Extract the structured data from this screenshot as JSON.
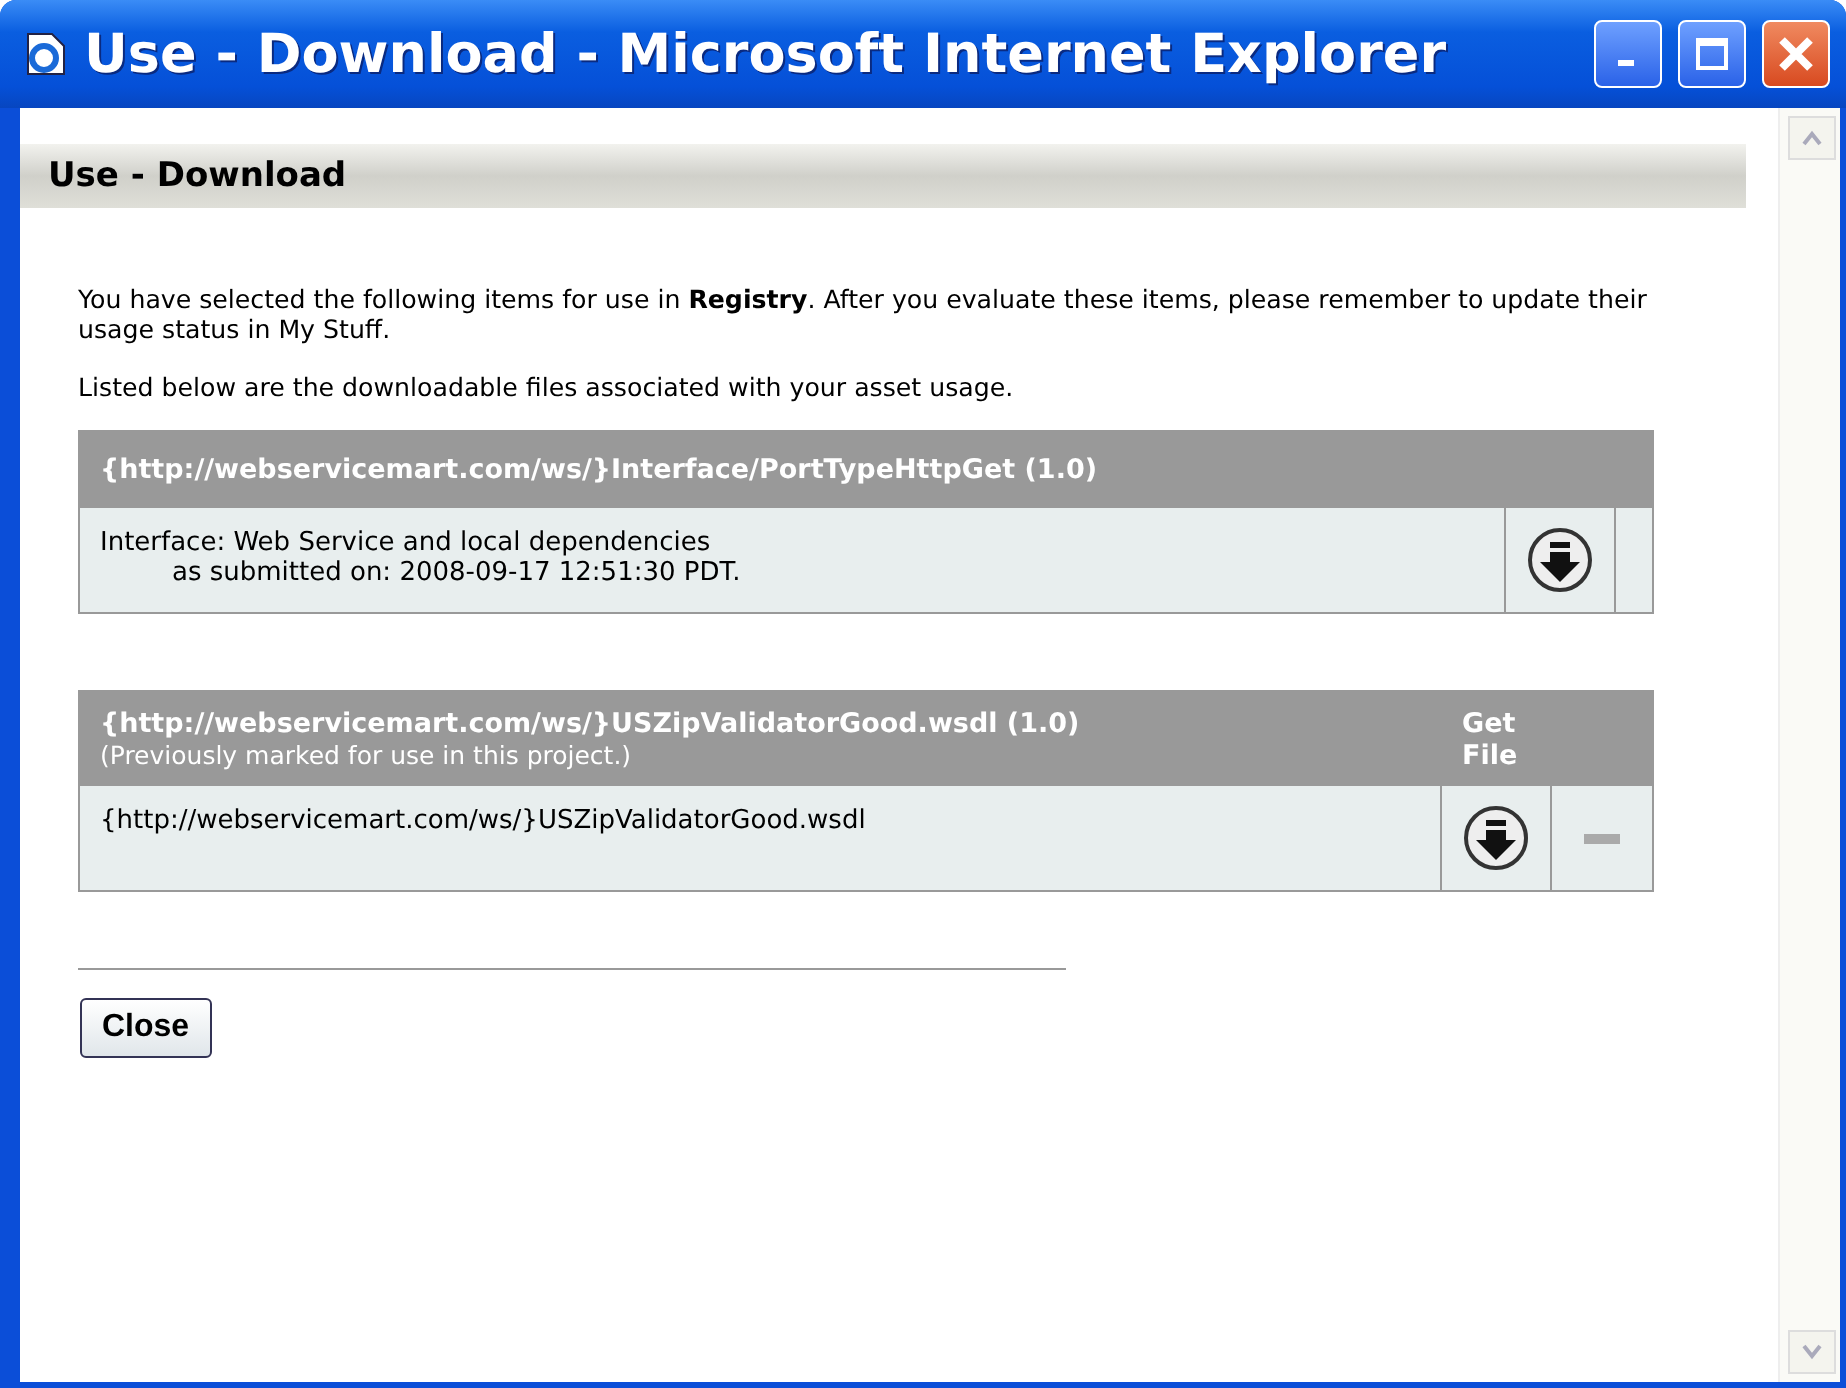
{
  "window": {
    "title": "Use - Download - Microsoft Internet Explorer"
  },
  "page_header": "Use - Download",
  "intro": "You have selected the following items for use in **Registry**. After you evaluate these items, please remember to update their usage status in My Stuff.",
  "listing_note": "Listed below are the downloadable files associated with your asset usage.",
  "assets": [
    {
      "title": "{http://webservicemart.com/ws/}Interface/PortTypeHttpGet (1.0)",
      "description": [
        "Interface: Web Service and local dependencies",
        "as submitted on: 2008-09-17 12:51:30 PDT."
      ],
      "actions": [
        {
          "kind": "download"
        },
        {
          "kind": "empty"
        }
      ]
    },
    {
      "title": "{http://webservicemart.com/ws/}USZipValidatorGood.wsdl (1.0)",
      "subtitle": "(Previously marked for use in this project.)",
      "column_header": "Get File",
      "description": [
        "{http://webservicemart.com/ws/}USZipValidatorGood.wsdl"
      ],
      "actions": [
        {
          "kind": "download"
        },
        {
          "kind": "remove"
        }
      ]
    }
  ],
  "buttons": [
    "Close"
  ]
}
